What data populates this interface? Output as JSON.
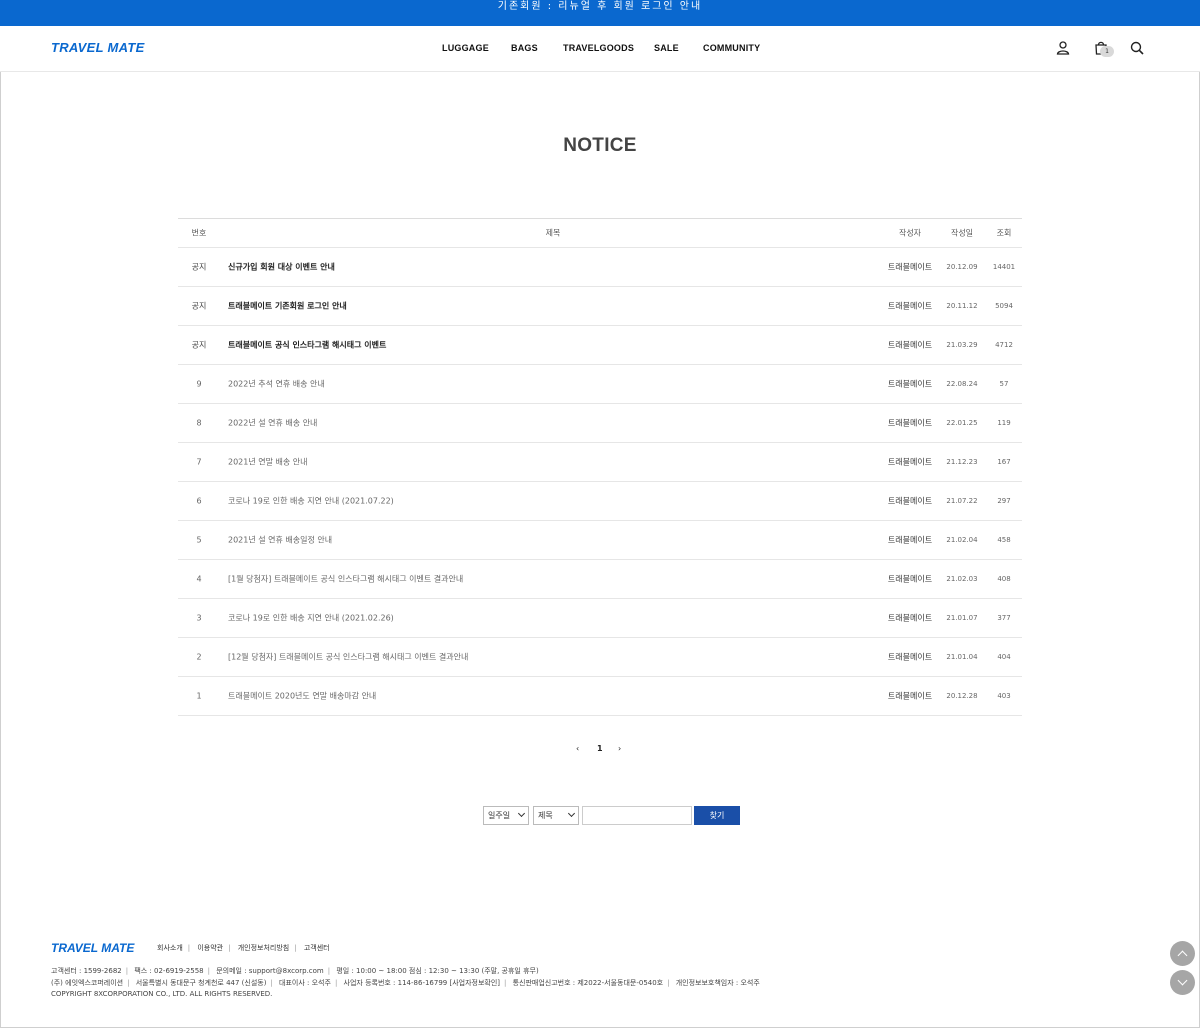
{
  "top_banner": "기존회원 : 리뉴얼 후 회원 로그인 안내",
  "brand": "TRAVEL MATE",
  "nav": [
    "LUGGAGE",
    "BAGS",
    "TRAVELGOODS",
    "SALE",
    "COMMUNITY"
  ],
  "icons": {
    "user": "user-icon",
    "cart": "cart-icon",
    "search": "search-icon"
  },
  "cart_count": "1",
  "page_title": "NOTICE",
  "table": {
    "headers": {
      "no": "번호",
      "title": "제목",
      "writer": "작성자",
      "date": "작성일",
      "hits": "조회"
    },
    "rows": [
      {
        "no": "공지",
        "title": "신규가입 회원 대상 이벤트 안내",
        "writer": "트래블메이트",
        "date": "20.12.09",
        "hits": "14401",
        "notice": true
      },
      {
        "no": "공지",
        "title": "트래블메이트 기존회원 로그인 안내",
        "writer": "트래블메이트",
        "date": "20.11.12",
        "hits": "5094",
        "notice": true
      },
      {
        "no": "공지",
        "title": "트래블메이트 공식 인스타그램 해시태그 이벤트",
        "writer": "트래블메이트",
        "date": "21.03.29",
        "hits": "4712",
        "notice": true
      },
      {
        "no": "9",
        "title": "2022년 추석 연휴 배송 안내",
        "writer": "트래블메이트",
        "date": "22.08.24",
        "hits": "57",
        "notice": false
      },
      {
        "no": "8",
        "title": "2022년 설 연휴 배송 안내",
        "writer": "트래블메이트",
        "date": "22.01.25",
        "hits": "119",
        "notice": false
      },
      {
        "no": "7",
        "title": "2021년 연말 배송 안내",
        "writer": "트래블메이트",
        "date": "21.12.23",
        "hits": "167",
        "notice": false
      },
      {
        "no": "6",
        "title": "코로나 19로 인한 배송 지연 안내 (2021.07.22)",
        "writer": "트래블메이트",
        "date": "21.07.22",
        "hits": "297",
        "notice": false
      },
      {
        "no": "5",
        "title": "2021년 설 연휴 배송일정 안내",
        "writer": "트래블메이트",
        "date": "21.02.04",
        "hits": "458",
        "notice": false
      },
      {
        "no": "4",
        "title": "[1월 당첨자] 트래블메이트 공식 인스타그램 해시태그 이벤트 결과안내",
        "writer": "트래블메이트",
        "date": "21.02.03",
        "hits": "408",
        "notice": false
      },
      {
        "no": "3",
        "title": "코로나 19로 인한 배송 지연 안내 (2021.02.26)",
        "writer": "트래블메이트",
        "date": "21.01.07",
        "hits": "377",
        "notice": false
      },
      {
        "no": "2",
        "title": "[12월 당첨자] 트래블메이트 공식 인스타그램 해시태그 이벤트 결과안내",
        "writer": "트래블메이트",
        "date": "21.01.04",
        "hits": "404",
        "notice": false
      },
      {
        "no": "1",
        "title": "트래블메이트 2020년도 연말 배송마감 안내",
        "writer": "트래블메이트",
        "date": "20.12.28",
        "hits": "403",
        "notice": false
      }
    ]
  },
  "pagination": {
    "prev": "‹",
    "current": "1",
    "next": "›"
  },
  "search": {
    "period": "일주일",
    "field": "제목",
    "query": "",
    "button": "찾기"
  },
  "footer": {
    "brand": "TRAVEL MATE",
    "links": [
      "회사소개",
      "이용약관",
      "개인정보처리방침",
      "고객센터"
    ],
    "line1": [
      "고객센터 : 1599-2682",
      "팩스 : 02-6919-2558",
      "문의메일 : support@8xcorp.com",
      "평일 : 10:00 ~ 18:00 점심 : 12:30 ~ 13:30 (주말, 공휴일 휴무)"
    ],
    "line2": [
      "(주) 에잇엑스코퍼레이션",
      "서울특별시 동대문구 청계천로 447 (신설동)",
      "대표이사 : 오석주",
      "사업자 등록번호 : 114-86-16799 [사업자정보확인]",
      "통신판매업신고번호 : 제2022-서울동대문-0540호",
      "개인정보보호책임자 : 오석주"
    ],
    "copyright": "COPYRIGHT 8XCORPORATION CO., LTD. ALL RIGHTS RESERVED."
  }
}
